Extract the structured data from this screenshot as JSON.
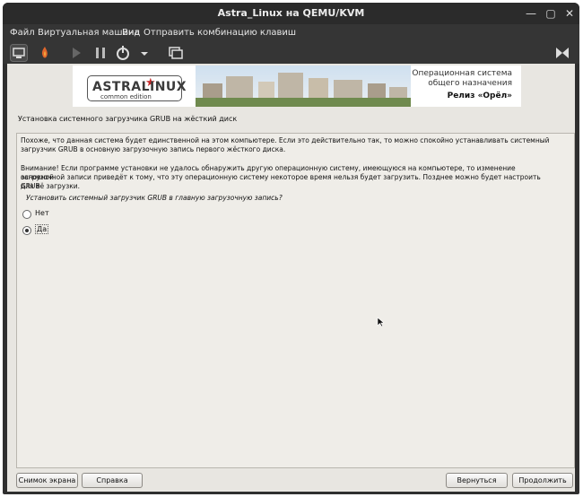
{
  "window": {
    "title": "Astra_Linux на QEMU/KVM"
  },
  "menu": [
    "Файл",
    "Виртуальная машина",
    "Вид",
    "Отправить комбинацию клавиш"
  ],
  "banner": {
    "logo_main": "ASTRALINUX",
    "logo_sub": "common edition",
    "os_line1": "Операционная система",
    "os_line2": "общего назначения",
    "release": "Релиз «Орёл»"
  },
  "page": {
    "heading": "Установка системного загрузчика GRUB на жёсткий диск",
    "para1_line1": "Похоже, что данная система будет единственной на этом компьютере. Если это действительно так, то можно спокойно устанавливать системный",
    "para1_line2": "загрузчик GRUB в основную загрузочную запись первого жёсткого диска.",
    "para2_line1": "Внимание! Если программе установки не удалось обнаружить другую операционную систему, имеющуюся на компьютере, то изменение основной",
    "para2_line2": "загрузочной записи приведёт к тому, что эту операционную систему некоторое время нельзя будет загрузить. Позднее можно будет настроить GRUB",
    "para2_line3": "для её загрузки.",
    "question": "Установить системный загрузчик GRUB в главную загрузочную запись?",
    "options": [
      {
        "label": "Нет",
        "selected": false
      },
      {
        "label": "Да",
        "selected": true
      }
    ]
  },
  "buttons": {
    "screenshot": "Снимок экрана",
    "help": "Справка",
    "back": "Вернуться",
    "continue": "Продолжить"
  }
}
